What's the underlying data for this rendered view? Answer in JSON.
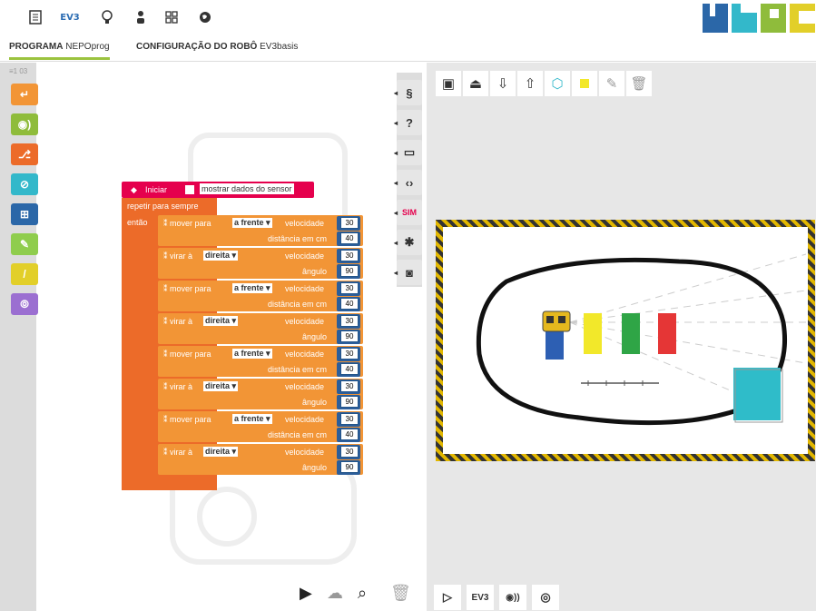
{
  "topbar": {
    "icons": [
      "document-icon",
      "ev3-icon",
      "lightbulb-icon",
      "person-icon",
      "grid-icon",
      "globe-icon"
    ],
    "ev3_label": "EV3",
    "logo_label": "NEPO"
  },
  "tabs": [
    {
      "bold": "PROGRAMA",
      "normal": " NEPOprog",
      "active": true
    },
    {
      "bold": "CONFIGURAÇÃO DO ROBÔ",
      "normal": " EV3basis",
      "active": false
    }
  ],
  "toolbox": {
    "counter": "≡1  03",
    "categories": [
      {
        "icon": "action-icon",
        "color": "#f29536"
      },
      {
        "icon": "sensor-icon",
        "color": "#8fbc3b"
      },
      {
        "icon": "control-icon",
        "color": "#ec6b29"
      },
      {
        "icon": "logic-icon",
        "color": "#33b8ca"
      },
      {
        "icon": "math-icon",
        "color": "#2b67a8"
      },
      {
        "icon": "text-icon",
        "color": "#8fcd4d"
      },
      {
        "icon": "colour-icon",
        "color": "#e2cf29"
      },
      {
        "icon": "variable-icon",
        "color": "#9b6fd1"
      }
    ]
  },
  "program": {
    "start_label": "Iniciar",
    "show_sensor_label": "mostrar dados do sensor",
    "repeat_label": "repetir para sempre",
    "do_label": "então",
    "statements": [
      {
        "kind": "move",
        "verb": "mover",
        "mid": "para",
        "dir": "a frente",
        "speed_label": "velocidade",
        "speed": "30",
        "second_label": "distância em cm",
        "second": "40"
      },
      {
        "kind": "turn",
        "verb": "virar à",
        "mid": "",
        "dir": "direita",
        "speed_label": "velocidade",
        "speed": "30",
        "second_label": "ângulo",
        "second": "90"
      },
      {
        "kind": "move",
        "verb": "mover",
        "mid": "para",
        "dir": "a frente",
        "speed_label": "velocidade",
        "speed": "30",
        "second_label": "distância em cm",
        "second": "40"
      },
      {
        "kind": "turn",
        "verb": "virar à",
        "mid": "",
        "dir": "direita",
        "speed_label": "velocidade",
        "speed": "30",
        "second_label": "ângulo",
        "second": "90"
      },
      {
        "kind": "move",
        "verb": "mover",
        "mid": "para",
        "dir": "a frente",
        "speed_label": "velocidade",
        "speed": "30",
        "second_label": "distância em cm",
        "second": "40"
      },
      {
        "kind": "turn",
        "verb": "virar à",
        "mid": "",
        "dir": "direita",
        "speed_label": "velocidade",
        "speed": "30",
        "second_label": "ângulo",
        "second": "90"
      },
      {
        "kind": "move",
        "verb": "mover",
        "mid": "para",
        "dir": "a frente",
        "speed_label": "velocidade",
        "speed": "30",
        "second_label": "distância em cm",
        "second": "40"
      },
      {
        "kind": "turn",
        "verb": "virar à",
        "mid": "",
        "dir": "direita",
        "speed_label": "velocidade",
        "speed": "30",
        "second_label": "ângulo",
        "second": "90"
      }
    ]
  },
  "side_buttons": [
    {
      "label": "§",
      "name": "code-view-button"
    },
    {
      "label": "?",
      "name": "help-button"
    },
    {
      "label": "▭",
      "name": "info-button"
    },
    {
      "label": "‹›",
      "name": "source-button"
    },
    {
      "label": "SIM",
      "name": "sim-button"
    },
    {
      "label": "✱",
      "name": "debug-button"
    },
    {
      "label": "◙",
      "name": "robot-view-button"
    }
  ],
  "sim_tools": [
    "image-icon",
    "upload-icon",
    "import-icon",
    "export-icon",
    "cube-icon",
    "yellow-square-icon",
    "pencil-icon",
    "trash-icon"
  ],
  "sim_bottom": {
    "play": "▷",
    "ev3": "EV3",
    "sensor": "◉))",
    "location": "◎"
  },
  "workspace_bottom": [
    "play-icon",
    "cloud-icon",
    "zoom-icon",
    "trash-icon"
  ],
  "scene": {
    "colors": {
      "blue": "#2d5fb3",
      "yellow": "#f2e82a",
      "green": "#2fa546",
      "red": "#e53636",
      "teal": "#2fbcc9",
      "robot": "#e5b81e"
    }
  }
}
